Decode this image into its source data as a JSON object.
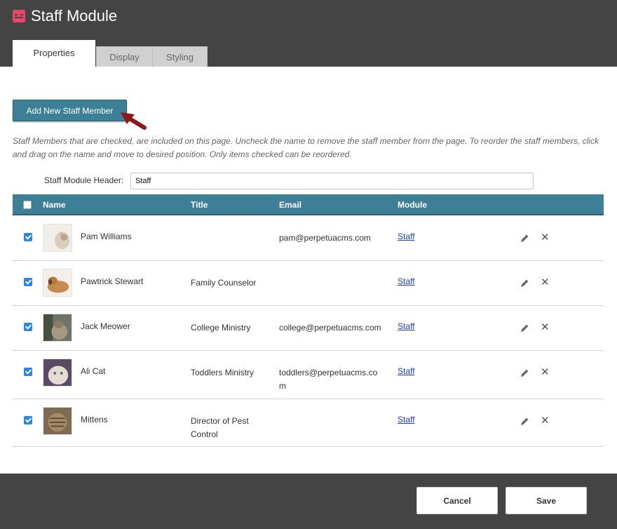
{
  "window": {
    "title": "Staff Module"
  },
  "tabs": [
    {
      "label": "Properties",
      "active": true
    },
    {
      "label": "Display",
      "active": false
    },
    {
      "label": "Styling",
      "active": false
    }
  ],
  "toolbar": {
    "add_label": "Add New Staff Member"
  },
  "info_text": "Staff Members that are checked, are included on this page. Uncheck the name to remove the staff member from the page. To reorder the staff members, click and drag on the name and move to desired position. Only items checked can be reordered.",
  "header_field": {
    "label": "Staff Module Header:",
    "value": "Staff"
  },
  "table": {
    "columns": [
      "Name",
      "Title",
      "Email",
      "Module"
    ],
    "rows": [
      {
        "checked": true,
        "name": "Pam Williams",
        "title": "",
        "email": "pam@perpetuacms.com",
        "module": "Staff",
        "photo": "cat-photo"
      },
      {
        "checked": true,
        "name": "Pawtrick Stewart",
        "title": "Family Counselor",
        "email": "",
        "module": "Staff",
        "photo": "dog-photo"
      },
      {
        "checked": true,
        "name": "Jack Meower",
        "title": "College Ministry",
        "email": "college@perpetuacms.com",
        "module": "Staff",
        "photo": "cat-photo"
      },
      {
        "checked": true,
        "name": "Ali Cat",
        "title": "Toddlers Ministry",
        "email": "toddlers@perpetuacms.com",
        "module": "Staff",
        "photo": "cat-photo"
      },
      {
        "checked": true,
        "name": "Mittens",
        "title": "Director of Pest Control",
        "email": "",
        "module": "Staff",
        "photo": "cat-photo"
      }
    ]
  },
  "footer": {
    "cancel_label": "Cancel",
    "save_label": "Save"
  },
  "icons": {
    "edit": "pencil-icon",
    "delete": "close-icon",
    "logo": "module-logo-icon"
  },
  "colors": {
    "header_bg": "#444444",
    "accent": "#3e7f98",
    "logo": "#e8466b",
    "link": "#1d3dd0",
    "arrow": "#8b1a1a"
  }
}
